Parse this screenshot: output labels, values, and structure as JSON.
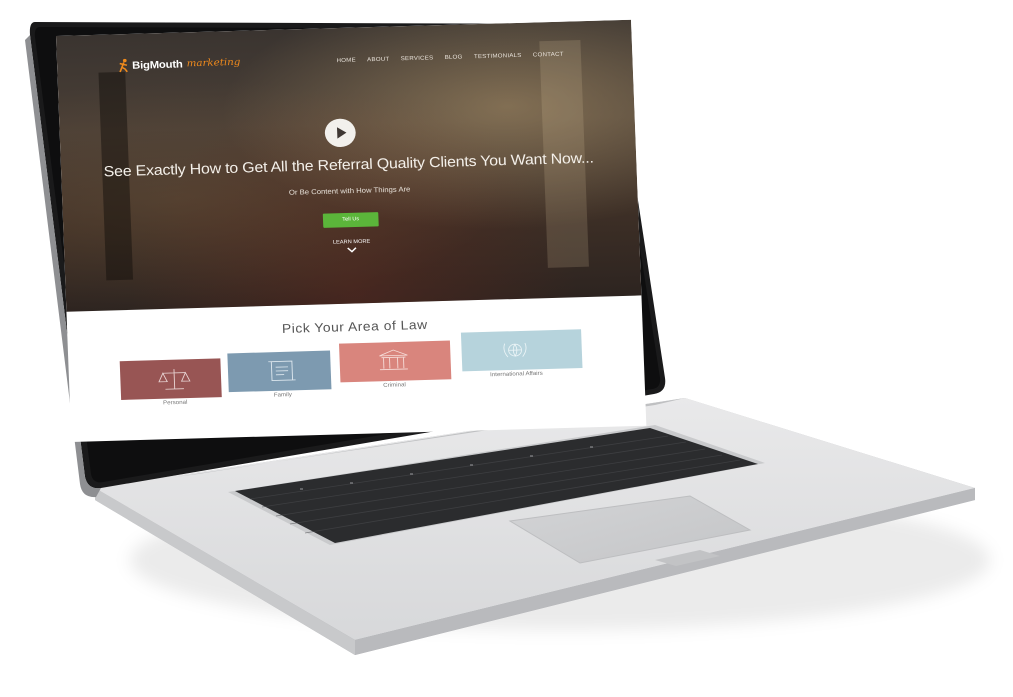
{
  "site": {
    "logo_primary": "BigMouth",
    "logo_accent": "marketing",
    "nav": [
      "HOME",
      "ABOUT",
      "SERVICES",
      "BLOG",
      "TESTIMONIALS",
      "CONTACT"
    ]
  },
  "hero": {
    "headline": "See Exactly How to Get All the Referral Quality Clients You Want Now...",
    "subheadline": "Or Be Content with How Things Are",
    "cta_label": "Tell Us",
    "learn_more": "LEARN MORE"
  },
  "areas": {
    "title": "Pick Your Area of Law",
    "items": [
      {
        "label": "Personal",
        "color": "#985554",
        "icon": "scales-icon"
      },
      {
        "label": "Family",
        "color": "#7d9ab0",
        "icon": "scroll-icon"
      },
      {
        "label": "Criminal",
        "color": "#d9857d",
        "icon": "courthouse-icon"
      },
      {
        "label": "International Affairs",
        "color": "#b6d3dc",
        "icon": "globe-laurel-icon"
      }
    ]
  },
  "colors": {
    "accent": "#f08a1c",
    "cta": "#5bb53a"
  }
}
